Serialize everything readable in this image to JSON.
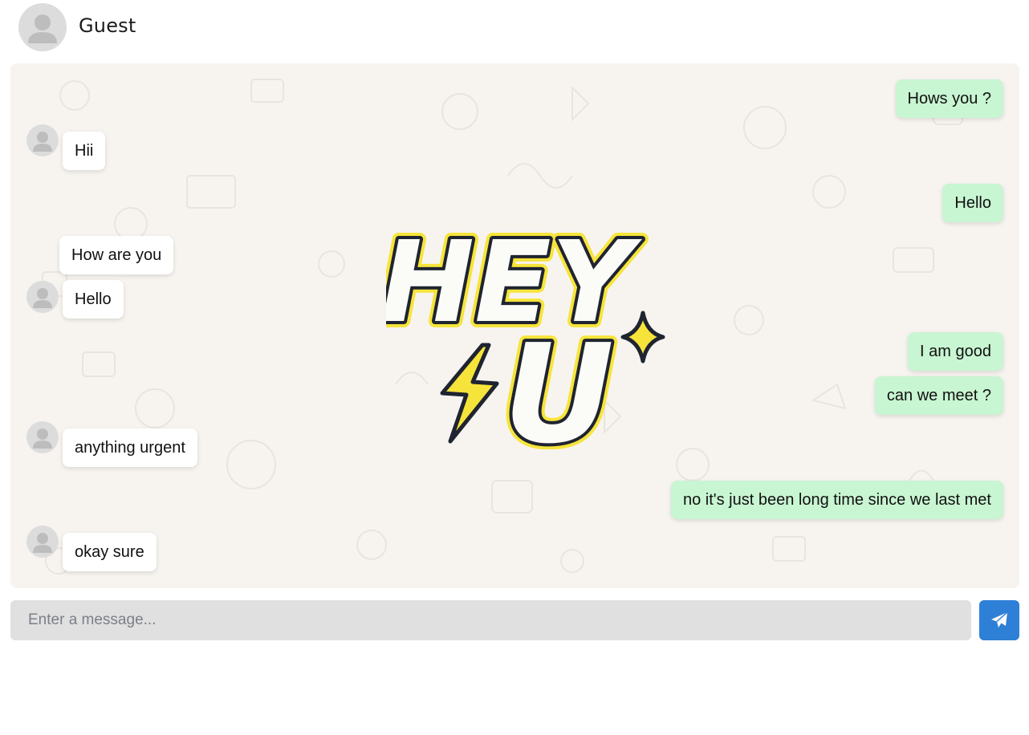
{
  "header": {
    "name": "Guest",
    "avatar_icon": "user-avatar-icon"
  },
  "sticker": {
    "line1": "HEY",
    "line2": "U",
    "colors": {
      "outline": "#f6e43b",
      "stroke": "#1f2430",
      "fill": "#fbfbf8"
    }
  },
  "messages": [
    {
      "side": "out",
      "text": "Hows you ?"
    },
    {
      "side": "in",
      "text": "Hii"
    },
    {
      "side": "out",
      "text": "Hello"
    },
    {
      "side": "in",
      "text": "How are you"
    },
    {
      "side": "in",
      "text": "Hello"
    },
    {
      "side": "out",
      "text": "I am good"
    },
    {
      "side": "out",
      "text": "can we meet ?"
    },
    {
      "side": "in",
      "text": "anything urgent"
    },
    {
      "side": "out",
      "text": "no it's just been long time since we last met"
    },
    {
      "side": "in",
      "text": "okay sure"
    }
  ],
  "composer": {
    "placeholder": "Enter a message...",
    "value": "",
    "send_icon": "paper-plane-icon"
  },
  "colors": {
    "incoming": "#ffffff",
    "outgoing": "#c8f5d2",
    "chat_bg": "#f7f4f0",
    "send_button": "#2e7fd6",
    "input_bg": "#e0e0e0"
  }
}
